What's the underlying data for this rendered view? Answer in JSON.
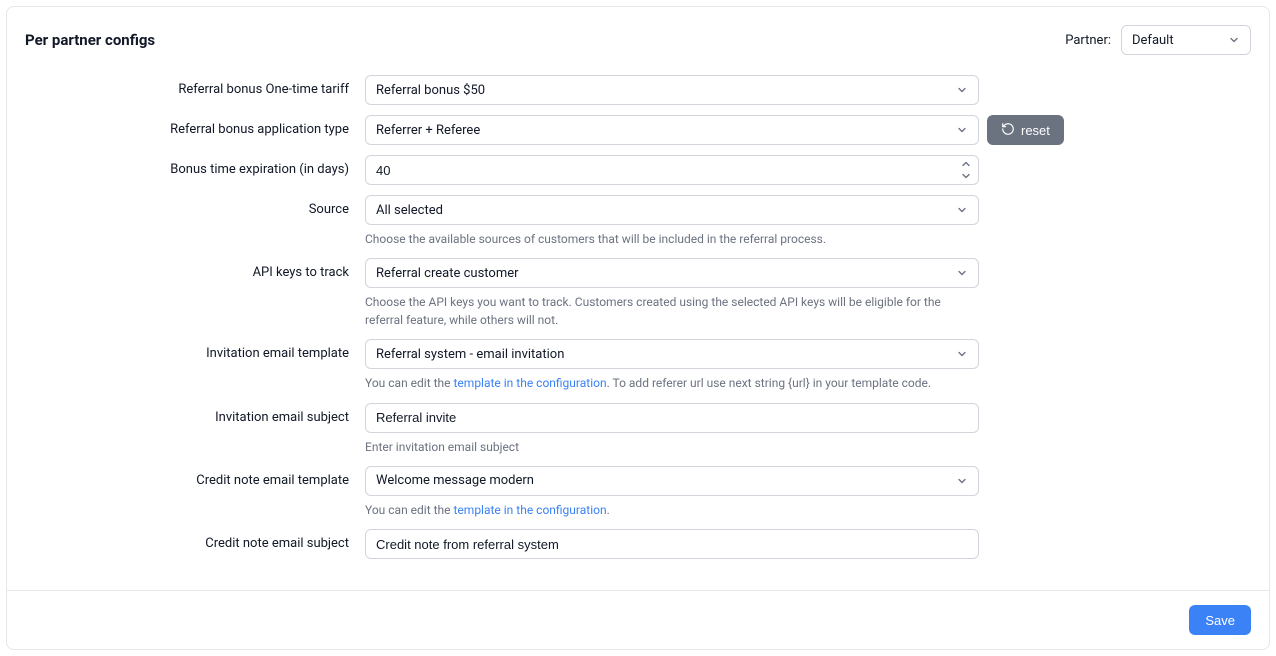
{
  "header": {
    "title": "Per partner configs",
    "partner_label": "Partner:",
    "partner_value": "Default"
  },
  "form": {
    "referral_bonus_tariff": {
      "label": "Referral bonus One-time tariff",
      "value": "Referral bonus $50"
    },
    "referral_bonus_app_type": {
      "label": "Referral bonus application type",
      "value": "Referrer + Referee",
      "reset_label": "reset"
    },
    "bonus_time_expiration": {
      "label": "Bonus time expiration (in days)",
      "value": "40"
    },
    "source": {
      "label": "Source",
      "value": "All selected",
      "help": "Choose the available sources of customers that will be included in the referral process."
    },
    "api_keys": {
      "label": "API keys to track",
      "value": "Referral create customer",
      "help": "Choose the API keys you want to track. Customers created using the selected API keys will be eligible for the referral feature, while others will not."
    },
    "invitation_email_template": {
      "label": "Invitation email template",
      "value": "Referral system - email invitation",
      "help_pre": "You can edit the ",
      "help_link": "template in the configuration",
      "help_post": ". To add referer url use next string {url} in your template code."
    },
    "invitation_email_subject": {
      "label": "Invitation email subject",
      "value": "Referral invite",
      "help": "Enter invitation email subject"
    },
    "credit_note_template": {
      "label": "Credit note email template",
      "value": "Welcome message modern",
      "help_pre": "You can edit the ",
      "help_link": "template in the configuration",
      "help_post": "."
    },
    "credit_note_subject": {
      "label": "Credit note email subject",
      "value": "Credit note from referral system"
    }
  },
  "footer": {
    "save_label": "Save"
  }
}
